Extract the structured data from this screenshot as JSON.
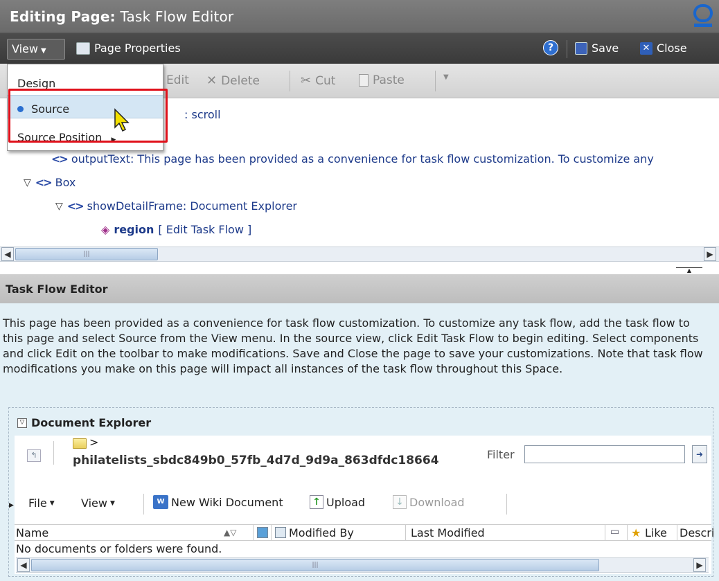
{
  "titlebar": {
    "prefix": "Editing Page:",
    "name": "Task Flow Editor"
  },
  "menubar": {
    "view_label": "View",
    "page_properties": "Page Properties",
    "save_label": "Save",
    "close_label": "Close"
  },
  "toolbar": {
    "edit": "Edit",
    "delete": "Delete",
    "cut": "Cut",
    "paste": "Paste"
  },
  "view_menu": {
    "items": [
      "Design",
      "Source",
      "Source Position"
    ],
    "selected": "Source"
  },
  "tree": {
    "partial_node": ": scroll",
    "nodes": [
      {
        "label": "outputText: This page has been provided as a convenience for task flow customization. To customize any"
      },
      {
        "label": "Box"
      },
      {
        "label": "showDetailFrame: Document Explorer"
      }
    ],
    "region_label": "region",
    "region_action": "[  Edit Task Flow  ]"
  },
  "tfe": {
    "header": "Task Flow Editor",
    "description": "This page has been provided as a convenience for task flow customization. To customize any task flow, add the task flow to this page and select Source from the View menu. In the source view, click Edit Task Flow to begin editing. Select components and click Edit on the toolbar to make modifications. Save and Close the page to save your customizations. Note that task flow modifications you make on this page will impact all instances of the task flow throughout this Space."
  },
  "doc_explorer": {
    "title": "Document Explorer",
    "breadcrumb_sep": ">",
    "folder_name": "philatelists_sbdc849b0_57fb_4d7d_9d9a_863dfdc18664",
    "filter_label": "Filter",
    "filter_value": "",
    "toolbar": {
      "file": "File",
      "view": "View",
      "new_wiki": "New Wiki Document",
      "upload": "Upload",
      "download": "Download"
    },
    "columns": [
      "Name",
      "Modified By",
      "Last Modified",
      "Like",
      "Descri"
    ],
    "empty_message": "No documents or folders were found."
  },
  "colors": {
    "selection_highlight": "#e0101a",
    "menu_selected_bg": "#d4e6f4",
    "panel_bg": "#e3f0f6"
  }
}
